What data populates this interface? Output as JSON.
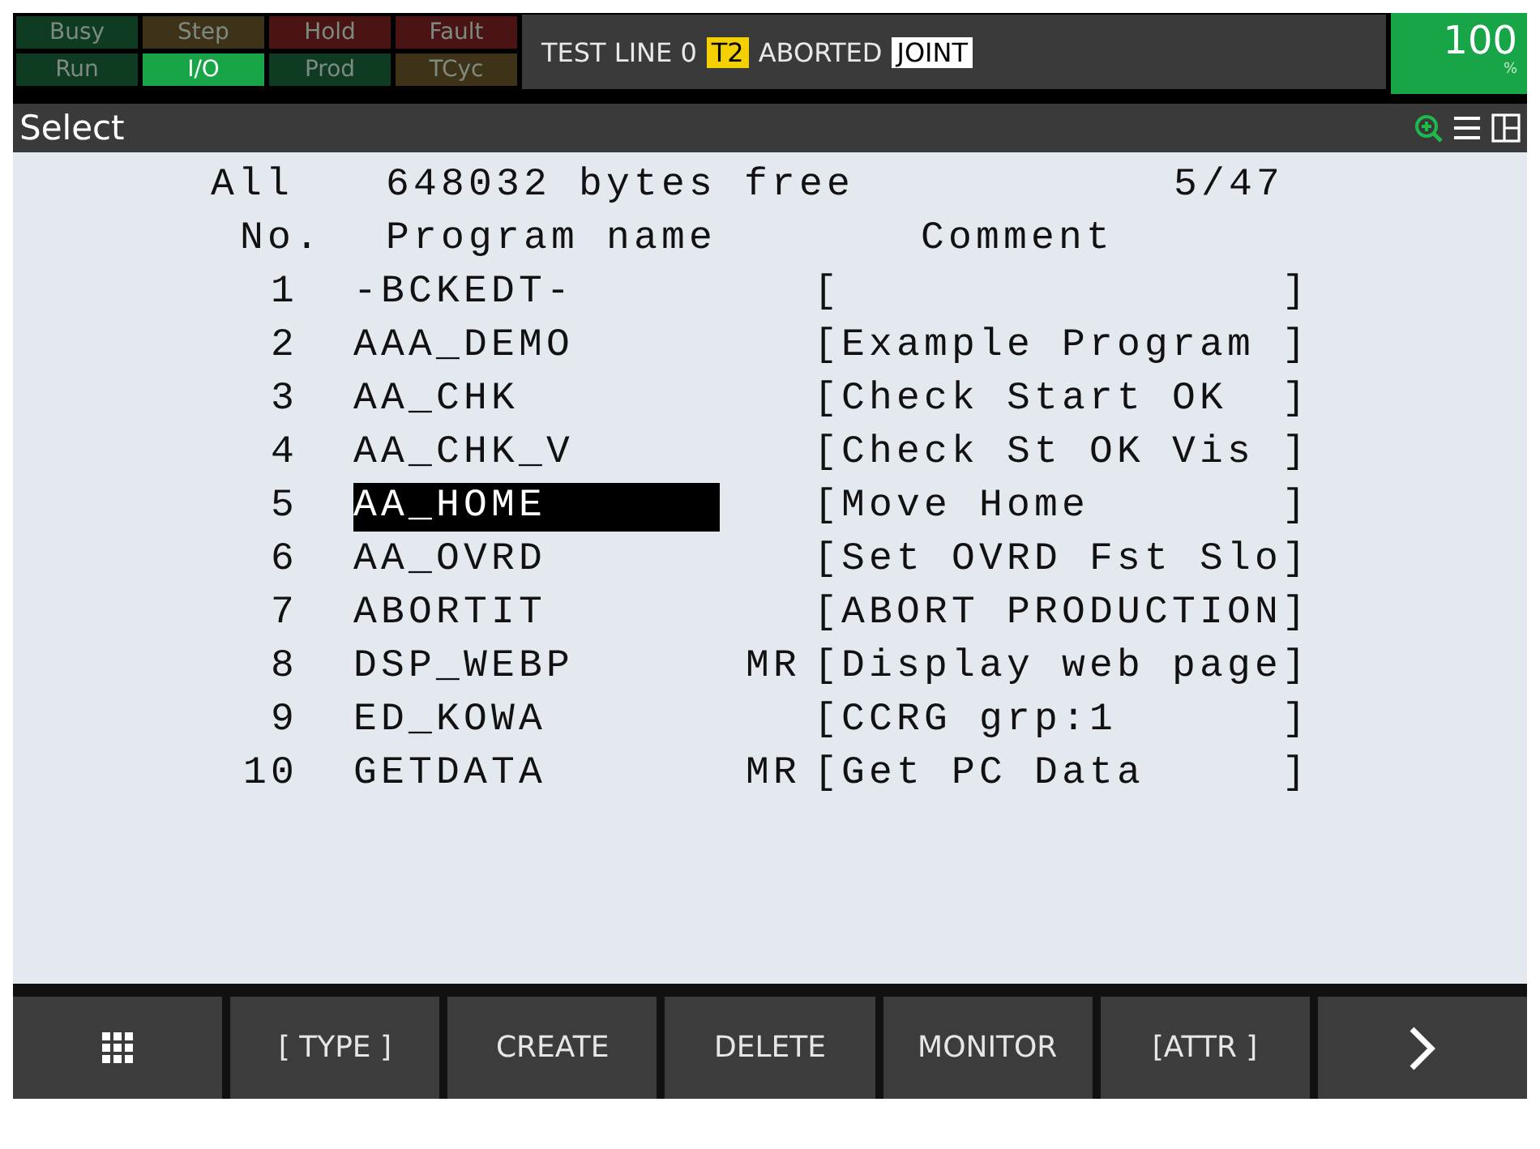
{
  "status_indicators": [
    {
      "label": "Busy",
      "on": false,
      "color": "#0f3b22"
    },
    {
      "label": "Step",
      "on": false,
      "color": "#3e3319"
    },
    {
      "label": "Hold",
      "on": false,
      "color": "#4a1414"
    },
    {
      "label": "Fault",
      "on": false,
      "color": "#4a1414"
    },
    {
      "label": "Run",
      "on": false,
      "color": "#0f3b22"
    },
    {
      "label": "I/O",
      "on": true,
      "color": "#17a548"
    },
    {
      "label": "Prod",
      "on": false,
      "color": "#0f3b22"
    },
    {
      "label": "TCyc",
      "on": false,
      "color": "#3e3319"
    }
  ],
  "status_line": {
    "line": "TEST LINE 0",
    "mode": "T2",
    "state": "ABORTED",
    "coord": "JOINT"
  },
  "override": {
    "value": "100",
    "unit": "%"
  },
  "screen_title": "Select",
  "summary": {
    "filter": "All",
    "free": "648032 bytes free",
    "position": "5/47"
  },
  "columns": {
    "number": "No.",
    "name": "Program name",
    "comment": "Comment"
  },
  "programs": [
    {
      "number": "1",
      "name": "-BCKEDT-",
      "comment": "[                ]",
      "selected": false
    },
    {
      "number": "2",
      "name": "AAA_DEMO",
      "comment": "[Example Program ]",
      "selected": false
    },
    {
      "number": "3",
      "name": "AA_CHK",
      "comment": "[Check Start OK  ]",
      "selected": false
    },
    {
      "number": "4",
      "name": "AA_CHK_V",
      "comment": "[Check St OK Vis ]",
      "selected": false
    },
    {
      "number": "5",
      "name": "AA_HOME",
      "comment": "[Move Home       ]",
      "selected": true
    },
    {
      "number": "6",
      "name": "AA_OVRD",
      "comment": "[Set OVRD Fst Slo]",
      "selected": false
    },
    {
      "number": "7",
      "name": "ABORTIT",
      "comment": "[ABORT PRODUCTION]",
      "selected": false
    },
    {
      "number": "8",
      "name": "DSP_WEBP",
      "attr": "MR",
      "comment": "[Display web page]",
      "selected": false
    },
    {
      "number": "9",
      "name": "ED_KOWA",
      "comment": "[CCRG grp:1      ]",
      "selected": false
    },
    {
      "number": "10",
      "name": "GETDATA",
      "attr": "MR",
      "comment": "[Get PC Data     ]",
      "selected": false
    }
  ],
  "function_keys": [
    {
      "kind": "menu"
    },
    {
      "kind": "text",
      "label": "[ TYPE ]"
    },
    {
      "kind": "text",
      "label": "CREATE"
    },
    {
      "kind": "text",
      "label": "DELETE"
    },
    {
      "kind": "text",
      "label": "MONITOR"
    },
    {
      "kind": "text",
      "label": "[ATTR ]"
    },
    {
      "kind": "next"
    }
  ]
}
